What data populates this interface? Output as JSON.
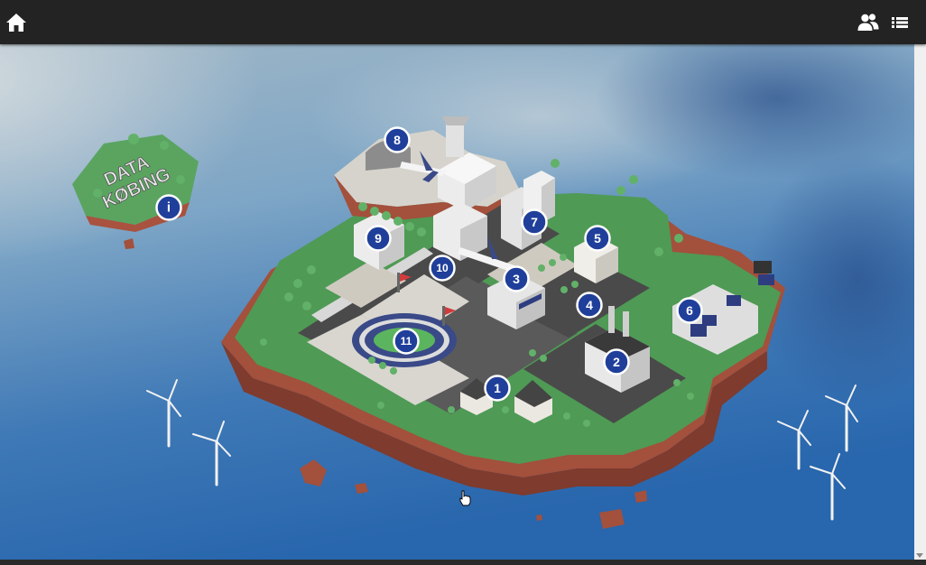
{
  "toolbar": {
    "home_icon": "home-icon",
    "users_icon": "users-icon",
    "list_icon": "list-icon"
  },
  "map": {
    "logo_text_line1": "DATA",
    "logo_text_line2": "KØBING",
    "info_marker": "i",
    "markers": [
      "1",
      "2",
      "3",
      "4",
      "5",
      "6",
      "7",
      "8",
      "9",
      "10",
      "11"
    ]
  },
  "colors": {
    "topbar": "#232323",
    "marker_fill": "#1f3f9a",
    "grass": "#4f9a55",
    "road": "#4a4a4a",
    "cliff": "#a8523f"
  }
}
